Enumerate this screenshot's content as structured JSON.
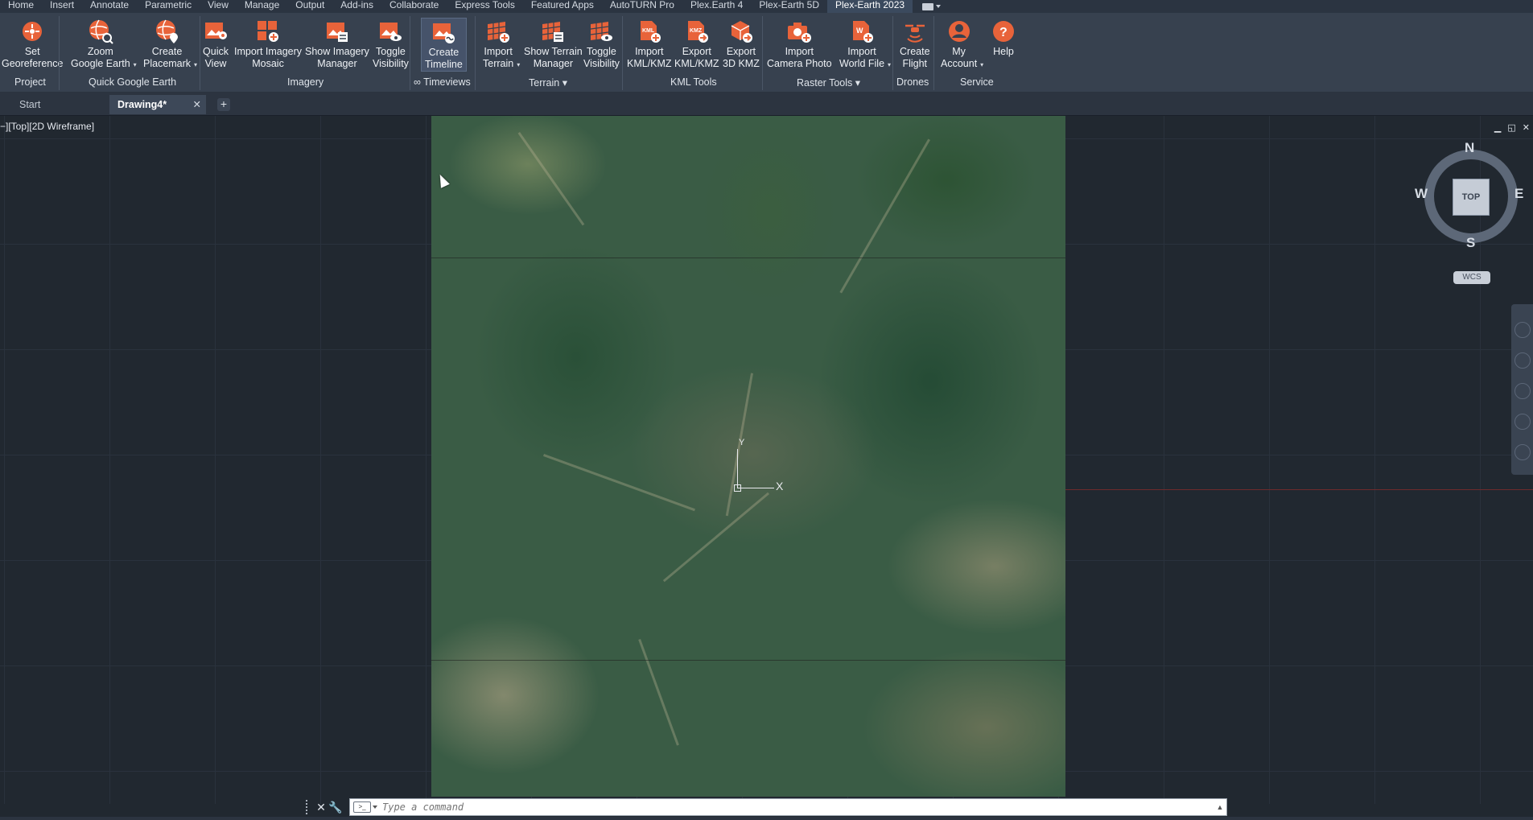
{
  "menu_tabs": [
    "Home",
    "Insert",
    "Annotate",
    "Parametric",
    "View",
    "Manage",
    "Output",
    "Add-ins",
    "Collaborate",
    "Express Tools",
    "Featured Apps",
    "AutoTURN Pro",
    "Plex.Earth 4",
    "Plex-Earth 5D",
    "Plex-Earth 2023"
  ],
  "active_menu_tab": "Plex-Earth 2023",
  "ribbon": {
    "buttons": {
      "set_georeference": {
        "line1": "Set",
        "line2": "Georeference"
      },
      "zoom_google_earth": {
        "line1": "Zoom",
        "line2": "Google Earth"
      },
      "create_placemark": {
        "line1": "Create",
        "line2": "Placemark"
      },
      "quick_view": {
        "line1": "Quick",
        "line2": "View"
      },
      "import_imagery_mosaic": {
        "line1": "Import Imagery",
        "line2": "Mosaic"
      },
      "show_imagery_manager": {
        "line1": "Show Imagery",
        "line2": "Manager"
      },
      "toggle_visibility_imagery": {
        "line1": "Toggle",
        "line2": "Visibility"
      },
      "create_timeline": {
        "line1": "Create",
        "line2": "Timeline"
      },
      "import_terrain": {
        "line1": "Import",
        "line2": "Terrain"
      },
      "show_terrain_manager": {
        "line1": "Show Terrain",
        "line2": "Manager"
      },
      "toggle_visibility_terrain": {
        "line1": "Toggle",
        "line2": "Visibility"
      },
      "import_kml": {
        "line1": "Import",
        "line2": "KML/KMZ"
      },
      "export_kml": {
        "line1": "Export",
        "line2": "KML/KMZ"
      },
      "export_3d_kmz": {
        "line1": "Export",
        "line2": "3D KMZ"
      },
      "import_camera_photo": {
        "line1": "Import",
        "line2": "Camera Photo"
      },
      "import_world_file": {
        "line1": "Import",
        "line2": "World File"
      },
      "create_flight": {
        "line1": "Create",
        "line2": "Flight"
      },
      "my_account": {
        "line1": "My",
        "line2": "Account"
      },
      "help": {
        "line1": "Help",
        "line2": ""
      }
    },
    "panels": {
      "project": "Project",
      "quick_google_earth": "Quick Google Earth",
      "imagery": "Imagery",
      "timeviews": "∞ Timeviews",
      "terrain": "Terrain",
      "kml_tools": "KML Tools",
      "raster_tools": "Raster Tools",
      "drones": "Drones",
      "service": "Service"
    }
  },
  "doc_tabs": {
    "start": "Start",
    "active": "Drawing4*",
    "close": "✕",
    "add": "+"
  },
  "viewport": {
    "label": "−][Top][2D Wireframe]",
    "controls": [
      "▁",
      "◱",
      "✕"
    ],
    "ucs_x": "X",
    "ucs_y": "Y"
  },
  "viewcube": {
    "top": "TOP",
    "north": "N",
    "south": "S",
    "east": "E",
    "west": "W",
    "wcs": "WCS"
  },
  "command_line": {
    "placeholder": "Type a command"
  },
  "colors": {
    "accent": "#e8633a",
    "ribbon_bg": "#37414f",
    "canvas_bg": "#212830"
  }
}
